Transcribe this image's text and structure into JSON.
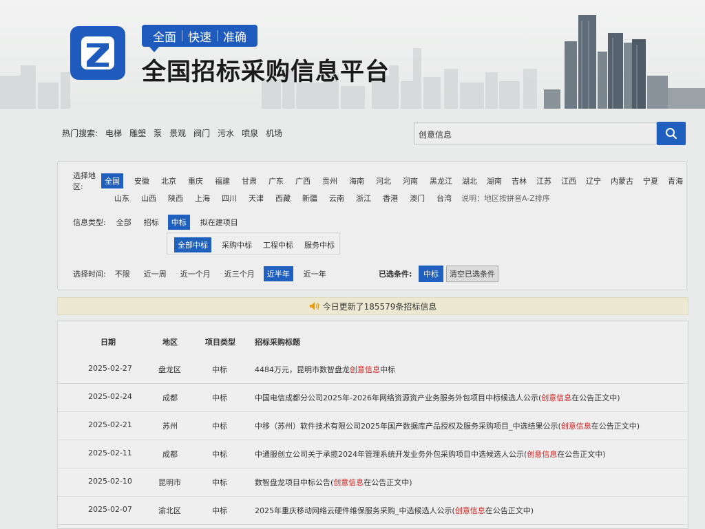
{
  "header": {
    "logo_letter": "Z",
    "tagline": [
      "全面",
      "快速",
      "准确"
    ],
    "title": "全国招标采购信息平台"
  },
  "search": {
    "hot_label": "热门搜索:",
    "hot_items": [
      "电梯",
      "雕塑",
      "泵",
      "景观",
      "阀门",
      "污水",
      "喷泉",
      "机场"
    ],
    "value": "创意信息"
  },
  "filters": {
    "region_label": "选择地区:",
    "regions_row1": [
      "全国",
      "安徽",
      "北京",
      "重庆",
      "福建",
      "甘肃",
      "广东",
      "广西",
      "贵州",
      "海南",
      "河北",
      "河南",
      "黑龙江",
      "湖北",
      "湖南",
      "吉林",
      "江苏",
      "江西",
      "辽宁",
      "内蒙古",
      "宁夏",
      "青海"
    ],
    "regions_row2": [
      "山东",
      "山西",
      "陕西",
      "上海",
      "四川",
      "天津",
      "西藏",
      "新疆",
      "云南",
      "浙江",
      "香港",
      "澳门",
      "台湾"
    ],
    "region_note": "说明：地区按拼音A-Z排序",
    "type_label": "信息类型:",
    "types": [
      "全部",
      "招标",
      "中标",
      "拟在建项目"
    ],
    "subtypes": [
      "全部中标",
      "采购中标",
      "工程中标",
      "服务中标"
    ],
    "time_label": "选择时间:",
    "times": [
      "不限",
      "近一周",
      "近一个月",
      "近三个月",
      "近半年",
      "近一年"
    ],
    "selected_label": "已选条件:",
    "selected_value": "中标",
    "clear_label": "清空已选条件"
  },
  "notice": {
    "text": "今日更新了185579条招标信息"
  },
  "table": {
    "headers": [
      "日期",
      "地区",
      "项目类型",
      "招标采购标题"
    ],
    "rows": [
      {
        "date": "2025-02-27",
        "region": "盘龙区",
        "type": "中标",
        "pre": "4484万元，昆明市数智盘龙",
        "kw": "创意信息",
        "post": "中标"
      },
      {
        "date": "2025-02-24",
        "region": "成都",
        "type": "中标",
        "pre": "中国电信成都分公司2025年-2026年网络资源资产业务服务外包项目中标候选人公示(",
        "kw": "创意信息",
        "post": "在公告正文中)"
      },
      {
        "date": "2025-02-21",
        "region": "苏州",
        "type": "中标",
        "pre": "中移（苏州）软件技术有限公司2025年国产数据库产品授权及服务采购项目_中选结果公示(",
        "kw": "创意信息",
        "post": "在公告正文中)"
      },
      {
        "date": "2025-02-11",
        "region": "成都",
        "type": "中标",
        "pre": "中通服创立公司关于承揽2024年管理系统开发业务外包采购项目中选候选人公示(",
        "kw": "创意信息",
        "post": "在公告正文中)"
      },
      {
        "date": "2025-02-10",
        "region": "昆明市",
        "type": "中标",
        "pre": "数智盘龙项目中标公告(",
        "kw": "创意信息",
        "post": "在公告正文中)"
      },
      {
        "date": "2025-02-07",
        "region": "渝北区",
        "type": "中标",
        "pre": "2025年重庆移动网络云硬件维保服务采购_中选候选人公示(",
        "kw": "创意信息",
        "post": "在公告正文中)"
      }
    ]
  },
  "colors": {
    "primary": "#1f5fbe",
    "keyword": "#d02020",
    "notice_bg": "#ece8d2"
  },
  "icons": {
    "search": "search-icon",
    "speaker": "speaker-icon",
    "logo": "logo-icon"
  }
}
